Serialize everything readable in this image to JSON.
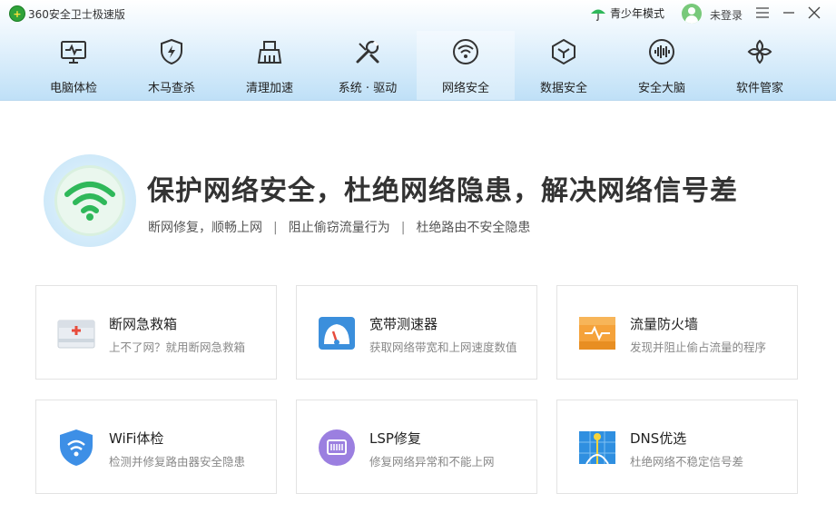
{
  "app": {
    "title": "360安全卫士极速版",
    "logo_char": "+"
  },
  "titlebar": {
    "youth_mode": "青少年模式",
    "login": "未登录"
  },
  "nav": [
    {
      "label": "电脑体检",
      "icon": "monitor-pulse-icon"
    },
    {
      "label": "木马查杀",
      "icon": "shield-bolt-icon"
    },
    {
      "label": "清理加速",
      "icon": "broom-icon"
    },
    {
      "label": "系统 · 驱动",
      "icon": "wrench-screwdriver-icon"
    },
    {
      "label": "网络安全",
      "icon": "wifi-icon",
      "active": true
    },
    {
      "label": "数据安全",
      "icon": "hexagon-cube-icon"
    },
    {
      "label": "安全大脑",
      "icon": "brain-wave-icon"
    },
    {
      "label": "软件管家",
      "icon": "flower-grid-icon"
    }
  ],
  "hero": {
    "title": "保护网络安全，杜绝网络隐患，解决网络信号差",
    "sub": [
      "断网修复，顺畅上网",
      "阻止偷窃流量行为",
      "杜绝路由不安全隐患"
    ],
    "separator": "|"
  },
  "cards": [
    {
      "title": "断网急救箱",
      "desc": "上不了网？就用断网急救箱",
      "icon": "first-aid-kit-icon"
    },
    {
      "title": "宽带测速器",
      "desc": "获取网络带宽和上网速度数值",
      "icon": "speedometer-icon"
    },
    {
      "title": "流量防火墙",
      "desc": "发现并阻止偷占流量的程序",
      "icon": "firewall-icon"
    },
    {
      "title": "WiFi体检",
      "desc": "检测并修复路由器安全隐患",
      "icon": "wifi-shield-icon"
    },
    {
      "title": "LSP修复",
      "desc": "修复网络异常和不能上网",
      "icon": "lsp-chip-icon"
    },
    {
      "title": "DNS优选",
      "desc": "杜绝网络不稳定信号差",
      "icon": "dns-globe-icon"
    }
  ],
  "colors": {
    "accent": "#2b9ae8",
    "green": "#2fb85a",
    "header_bottom": "#bfe0f7"
  }
}
